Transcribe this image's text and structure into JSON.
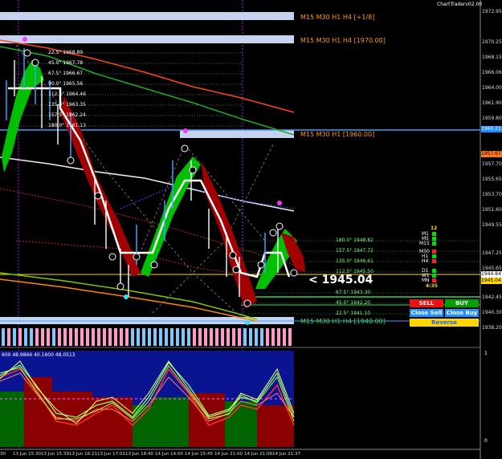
{
  "header": {
    "brand": "ChartTraderv02.00"
  },
  "prices": {
    "ticks": [
      "1972.95",
      "1970.25",
      "1968.15",
      "1966.06",
      "1964.00",
      "1961.90",
      "1959.80",
      "1957.70",
      "1955.65",
      "1953.70",
      "1951.60",
      "1949.55",
      "1947.25",
      "1945.65",
      "1942.45",
      "1940.30",
      "1938.20"
    ],
    "flag_top": "1960.21",
    "flag_mid": "1957.67",
    "flag_current": "1944.84",
    "flag_current2": "1945.04",
    "current_price": "1945.04"
  },
  "zones": [
    {
      "label": "M15 M30 H1 H4 [+1/8]",
      "color": "#ff9900"
    },
    {
      "label": "M15 M30 H1 H4 [1970.00]",
      "color": "#ff9900"
    },
    {
      "label": "M15 M30 H1 [1960.00]",
      "color": "#ff9900"
    },
    {
      "label": "M15 M30 H1 H4 [1940.00]",
      "color": "#39d353"
    }
  ],
  "fib_upper": [
    "22.5° 1968.89",
    "45.0° 1967.78",
    "67.5° 1966.67",
    "90.0° 1965.56",
    "112.5° 1964.46",
    "135.0° 1963.35",
    "157.5° 1962.24",
    "180.0° 1961.13"
  ],
  "fib_lower": [
    "180.0° 1948.82",
    "157.5° 1947.72",
    "135.0° 1946.61",
    "112.5° 1945.50",
    "67.5° 1943.30",
    "45.0° 1942.20",
    "22.5° 1941.10"
  ],
  "timeframes": [
    {
      "tf": "M1",
      "color": "#00e000"
    },
    {
      "tf": "M5",
      "color": "#00e000"
    },
    {
      "tf": "M15",
      "color": "#00e000"
    },
    {
      "tf": "M30",
      "color": "#ff2020"
    },
    {
      "tf": "H1",
      "color": "#00e000"
    },
    {
      "tf": "H4",
      "color": "#ff2020"
    },
    {
      "tf": "D1",
      "color": "#00e000"
    },
    {
      "tf": "W1",
      "color": "#00e000"
    },
    {
      "tf": "MN",
      "color": "#ff2020"
    }
  ],
  "counter_top": "12",
  "timer": "4:35",
  "trade_panel": {
    "sell": "SELL",
    "buy": "BUY",
    "close_sell": "Close Sell",
    "close_buy": "Close Buy",
    "reverse": "Reverse"
  },
  "indicator": {
    "header": "600 48.9866 40.1600 48.0513",
    "scale_top": "1",
    "scale_bottom": "0"
  },
  "time_axis": [
    "30",
    "13 Jun 15:30",
    "13 Jun 15:39",
    "13 Jun 16:21",
    "13 Jun 17:01",
    "13 Jun 18:40",
    "14 Jun 14:00",
    "14 Jun 15:45",
    "14 Jun 21:00",
    "14 Jun 21:06",
    "14 Jun 21:37"
  ]
}
